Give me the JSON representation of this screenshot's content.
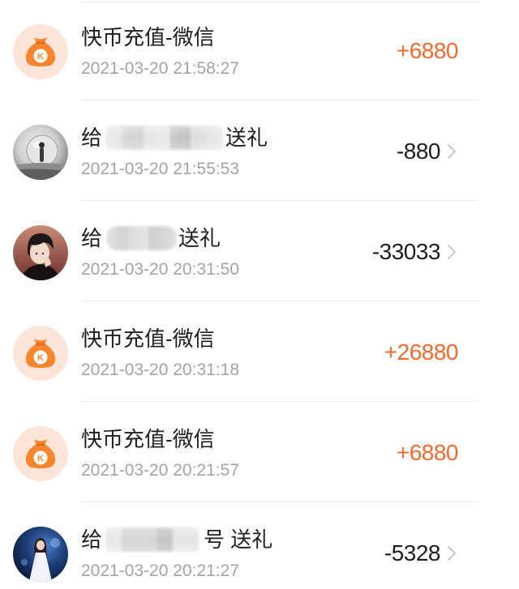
{
  "colors": {
    "income": "#f26a2d",
    "expense": "#1e1e1e",
    "title": "#1e1e1e",
    "secondary": "#a4a4a4",
    "divider": "#ececec",
    "chevron": "#c2c2c2",
    "coin_bag_bg": "#fde4d8",
    "coin_bag": "#f6852e"
  },
  "icons": {
    "recharge_badge_letter": "K"
  },
  "transactions": [
    {
      "icon": "coin-bag-icon",
      "title": "快币充值-微信",
      "time": "2021-03-20 21:58:27",
      "amount": "+6880",
      "amount_color": "#f26a2d"
    },
    {
      "icon": "avatar",
      "title_prefix": "给",
      "title_suffix": "送礼",
      "time": "2021-03-20 21:55:53",
      "amount": "-880",
      "amount_color": "#1e1e1e",
      "trailing_icon": "chevron-right-icon"
    },
    {
      "icon": "avatar",
      "title_prefix": "给",
      "title_suffix": "送礼",
      "time": "2021-03-20 20:31:50",
      "amount": "-33033",
      "amount_color": "#1e1e1e",
      "trailing_icon": "chevron-right-icon"
    },
    {
      "icon": "coin-bag-icon",
      "title": "快币充值-微信",
      "time": "2021-03-20 20:31:18",
      "amount": "+26880",
      "amount_color": "#f26a2d"
    },
    {
      "icon": "coin-bag-icon",
      "title": "快币充值-微信",
      "time": "2021-03-20 20:21:57",
      "amount": "+6880",
      "amount_color": "#f26a2d"
    },
    {
      "icon": "avatar",
      "title_prefix": "给",
      "title_suffix": "号 送礼",
      "time": "2021-03-20 20:21:27",
      "amount": "-5328",
      "amount_color": "#1e1e1e",
      "trailing_icon": "chevron-right-icon"
    }
  ]
}
